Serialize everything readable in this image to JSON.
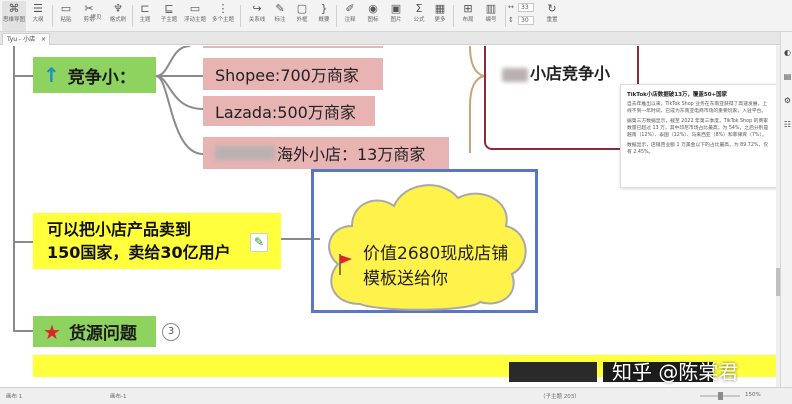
{
  "toolbar": {
    "items": [
      {
        "label": "思维导图",
        "icon": "mindmap-icon"
      },
      {
        "label": "大纲",
        "icon": "outline-icon"
      },
      {
        "label": "粘贴",
        "icon": "paste-icon"
      },
      {
        "label": "剪切",
        "icon": "cut-icon"
      },
      {
        "label": "拷贝",
        "icon": "copy-icon"
      },
      {
        "label": "格式刷",
        "icon": "format-brush-icon"
      },
      {
        "label": "主题",
        "icon": "topic-icon"
      },
      {
        "label": "子主题",
        "icon": "subtopic-icon"
      },
      {
        "label": "浮动主题",
        "icon": "floating-topic-icon"
      },
      {
        "label": "多个主题",
        "icon": "multi-topic-icon"
      },
      {
        "label": "关系线",
        "icon": "relation-icon"
      },
      {
        "label": "标注",
        "icon": "callout-icon"
      },
      {
        "label": "外框",
        "icon": "boundary-icon"
      },
      {
        "label": "概要",
        "icon": "summary-icon"
      },
      {
        "label": "注释",
        "icon": "note-icon"
      },
      {
        "label": "图标",
        "icon": "marker-icon"
      },
      {
        "label": "图片",
        "icon": "image-icon"
      },
      {
        "label": "公式",
        "icon": "formula-icon"
      },
      {
        "label": "更多",
        "icon": "more-icon"
      },
      {
        "label": "布局",
        "icon": "layout-icon"
      },
      {
        "label": "编号",
        "icon": "numbering-icon"
      },
      {
        "label": "重置",
        "icon": "reset-icon"
      }
    ],
    "spacing_values": [
      "33",
      "30"
    ]
  },
  "doc_tab": {
    "label": "Tyu - 小店"
  },
  "mindmap": {
    "competition_label": "竞争小：",
    "shopee": "Shopee:700万商家",
    "lazada": "Lazada:500万商家",
    "overseas_suffix": "海外小店：13万商家",
    "sell_line1": "可以把小店产品卖到",
    "sell_line2": "150国家，卖给30亿用户",
    "cloud_line1": "价值2680现成店铺",
    "cloud_line2": "模板送给你",
    "supply_label": "货源问题",
    "supply_badge": "3",
    "right_box_suffix": "小店竞争小"
  },
  "notes_panel": {
    "title": "TikTok小店数据破13万，覆盖50+国家",
    "p1": "自去年推出以来，TikTok Shop 业务在东南亚获得了高速发展，上线不到一年时间，已成为东南亚电商市场的重要玩家，入驻平台。",
    "p2": "据第三方数据显示，截至 2022 年第三季度，TikTok Shop 的商家数量已超过 13 万，其中印尼市场占比最高，为 54%，之后分别是越南（12%）、泰国（12%）、马来西亚（8%）和菲律宾（7%）。",
    "p3": "数据显示，店铺营业额 1 万美金以下的占比最高，为 89.72%，仅有 2.45%。"
  },
  "status": {
    "left": "画布 1",
    "mid": "画布-1",
    "topics": "（子主题 203）",
    "zoom": "150%"
  },
  "watermark": "知乎 @陈棠君",
  "colors": {
    "pink": "#e7b3b3",
    "green": "#8ed25f",
    "yellow": "#ffff3c",
    "selection": "#5a76c7",
    "box_border": "#8c2a3c",
    "arrow": "#1a8fc7",
    "star": "#d9262b"
  }
}
